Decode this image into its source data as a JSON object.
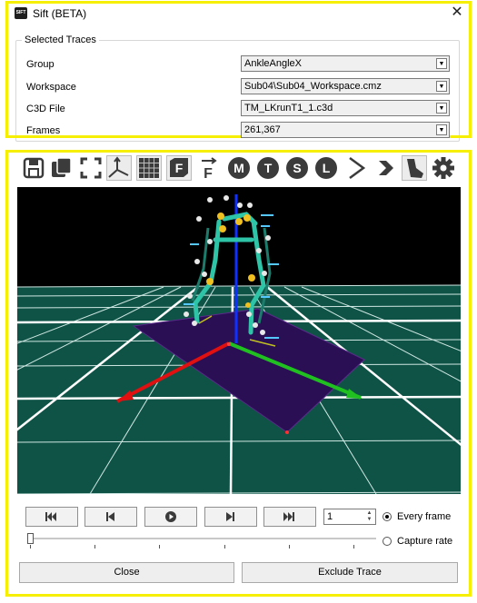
{
  "window": {
    "title": "Sift (BETA)",
    "icon_text": "SIFT",
    "close_glyph": "✕"
  },
  "selected_traces": {
    "title": "Selected Traces",
    "rows": [
      {
        "label": "Group",
        "value": "AnkleAngleX"
      },
      {
        "label": "Workspace",
        "value": "Sub04\\Sub04_Workspace.cmz"
      },
      {
        "label": "C3D File",
        "value": "TM_LKrunT1_1.c3d"
      },
      {
        "label": "Frames",
        "value": "261,367"
      }
    ]
  },
  "toolbar": {
    "icons": [
      "save-icon",
      "copy-icon",
      "fit-view-icon",
      "axes-icon",
      "grid-icon",
      "force-plate-icon",
      "force-vector-icon",
      "markers-icon",
      "targets-icon",
      "segments-icon",
      "landmarks-icon",
      "chevron-right-icon",
      "next-icon",
      "foot-icon",
      "gear-icon"
    ],
    "letters": {
      "markers": "M",
      "targets": "T",
      "segments": "S",
      "landmarks": "L",
      "force_plate": "F",
      "force_vector": "F"
    }
  },
  "playback": {
    "frame_value": "1",
    "options": [
      {
        "label": "Every frame",
        "selected": true
      },
      {
        "label": "Capture rate",
        "selected": false
      }
    ],
    "position": 0.0
  },
  "actions": {
    "close_label": "Close",
    "exclude_label": "Exclude Trace"
  },
  "colors": {
    "highlight": "#f7ef00",
    "grid": "#0f5347",
    "plate": "#2a0f55",
    "x_axis": "#e01010",
    "y_axis": "#20c020",
    "z_axis": "#1030ff"
  }
}
